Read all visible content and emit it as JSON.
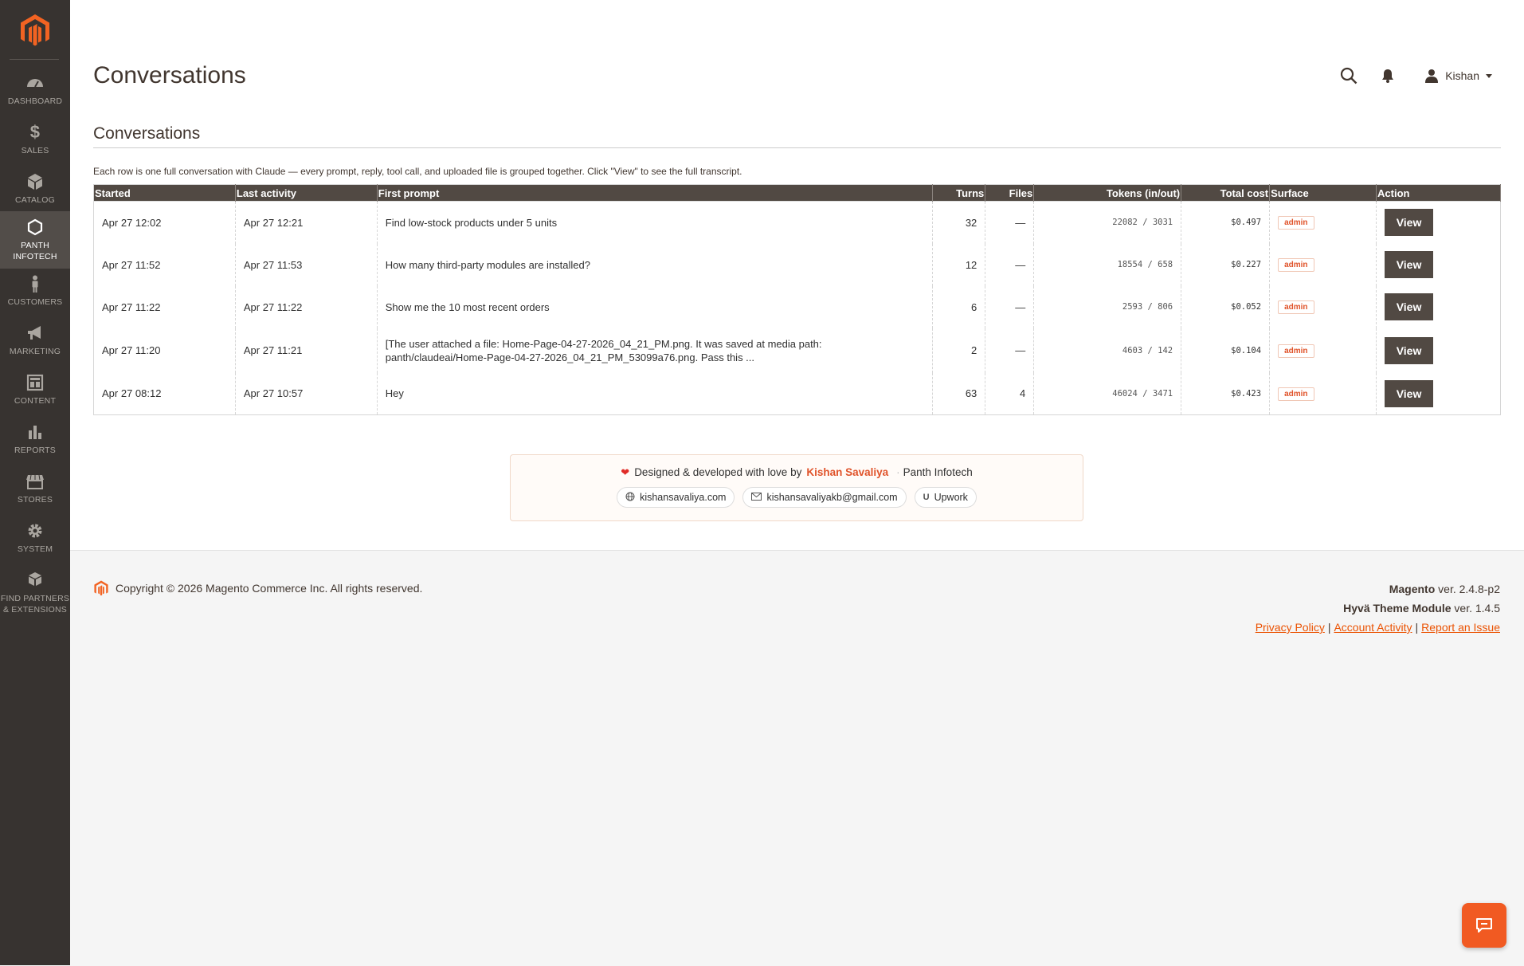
{
  "sidebar": {
    "items": [
      {
        "label": "DASHBOARD",
        "icon": "dashboard-gauge-icon"
      },
      {
        "label": "SALES",
        "icon": "dollar-icon"
      },
      {
        "label": "CATALOG",
        "icon": "cube-icon"
      },
      {
        "label_line1": "PANTH",
        "label_line2": "INFOTECH",
        "icon": "hexagon-icon"
      },
      {
        "label": "CUSTOMERS",
        "icon": "person-icon"
      },
      {
        "label": "MARKETING",
        "icon": "megaphone-icon"
      },
      {
        "label": "CONTENT",
        "icon": "layout-icon"
      },
      {
        "label": "REPORTS",
        "icon": "bar-chart-icon"
      },
      {
        "label": "STORES",
        "icon": "storefront-icon"
      },
      {
        "label": "SYSTEM",
        "icon": "gear-icon"
      },
      {
        "label_line1": "FIND PARTNERS",
        "label_line2": "& EXTENSIONS",
        "icon": "boxes-icon"
      }
    ]
  },
  "header": {
    "title": "Conversations",
    "user": "Kishan"
  },
  "section": {
    "title": "Conversations",
    "description": "Each row is one full conversation with Claude — every prompt, reply, tool call, and uploaded file is grouped together. Click \"View\" to see the full transcript."
  },
  "table": {
    "columns": {
      "started": "Started",
      "last_activity": "Last activity",
      "first_prompt": "First prompt",
      "turns": "Turns",
      "files": "Files",
      "tokens": "Tokens (in/out)",
      "total_cost": "Total cost",
      "surface": "Surface",
      "action": "Action"
    },
    "view_label": "View",
    "rows": [
      {
        "started": "Apr 27 12:02",
        "last_activity": "Apr 27 12:21",
        "first_prompt": "Find low-stock products under 5 units",
        "turns": "32",
        "files": "—",
        "tokens": "22082 / 3031",
        "cost": "$0.497",
        "surface": "admin"
      },
      {
        "started": "Apr 27 11:52",
        "last_activity": "Apr 27 11:53",
        "first_prompt": "How many third-party modules are installed?",
        "turns": "12",
        "files": "—",
        "tokens": "18554 / 658",
        "cost": "$0.227",
        "surface": "admin"
      },
      {
        "started": "Apr 27 11:22",
        "last_activity": "Apr 27 11:22",
        "first_prompt": "Show me the 10 most recent orders",
        "turns": "6",
        "files": "—",
        "tokens": "2593 / 806",
        "cost": "$0.052",
        "surface": "admin"
      },
      {
        "started": "Apr 27 11:20",
        "last_activity": "Apr 27 11:21",
        "first_prompt_line1": "[The user attached a file: Home-Page-04-27-2026_04_21_PM.png. It was saved at media path:",
        "first_prompt_line2": "panth/claudeai/Home-Page-04-27-2026_04_21_PM_53099a76.png. Pass this ...",
        "turns": "2",
        "files": "—",
        "tokens": "4603 / 142",
        "cost": "$0.104",
        "surface": "admin"
      },
      {
        "started": "Apr 27 08:12",
        "last_activity": "Apr 27 10:57",
        "first_prompt": "Hey",
        "turns": "63",
        "files": "4",
        "tokens": "46024 / 3471",
        "cost": "$0.423",
        "surface": "admin"
      }
    ]
  },
  "credit": {
    "text": "Designed & developed with love by",
    "author": "Kishan Savaliya",
    "company": "Panth Infotech",
    "links": {
      "website": "kishansavaliya.com",
      "email": "kishansavaliyakb@gmail.com",
      "upwork": "Upwork"
    }
  },
  "footer": {
    "copyright": "Copyright © 2026 Magento Commerce Inc. All rights reserved.",
    "magento_name": "Magento",
    "magento_version": "ver. 2.4.8-p2",
    "hyva_name": "Hyvä Theme Module",
    "hyva_version": "ver. 1.4.5",
    "privacy": "Privacy Policy",
    "activity": "Account Activity",
    "report": "Report an Issue"
  },
  "colors": {
    "sidebar_bg": "#373330",
    "accent": "#eb5202",
    "table_header": "#514943",
    "badge_text": "#e0532a"
  }
}
